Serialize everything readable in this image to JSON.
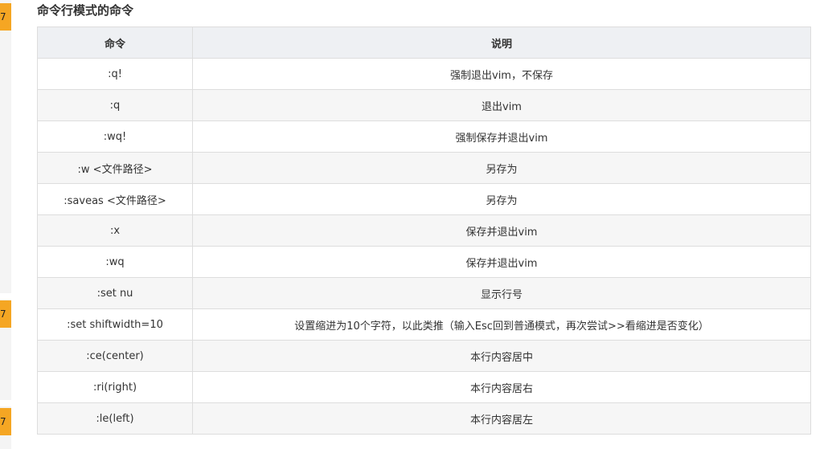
{
  "side_badges": [
    "7",
    "7",
    "7"
  ],
  "section": {
    "title": "命令行模式的命令"
  },
  "table": {
    "headers": {
      "command": "命令",
      "description": "说明"
    },
    "rows": [
      {
        "command": ":q!",
        "description": "强制退出vim，不保存"
      },
      {
        "command": ":q",
        "description": "退出vim"
      },
      {
        "command": ":wq!",
        "description": "强制保存并退出vim"
      },
      {
        "command": ":w <文件路径>",
        "description": "另存为"
      },
      {
        "command": ":saveas <文件路径>",
        "description": "另存为"
      },
      {
        "command": ":x",
        "description": "保存并退出vim"
      },
      {
        "command": ":wq",
        "description": "保存并退出vim"
      },
      {
        "command": ":set nu",
        "description": "显示行号"
      },
      {
        "command": ":set shiftwidth=10",
        "description": "设置缩进为10个字符，以此类推（输入Esc回到普通模式，再次尝试>>看缩进是否变化）"
      },
      {
        "command": ":ce(center)",
        "description": "本行内容居中"
      },
      {
        "command": ":ri(right)",
        "description": "本行内容居右"
      },
      {
        "command": ":le(left)",
        "description": "本行内容居左"
      }
    ]
  },
  "colors": {
    "badge": "#f5a623",
    "header_bg": "#eef0f3",
    "border": "#dddddd",
    "stripe": "#f6f6f6"
  }
}
